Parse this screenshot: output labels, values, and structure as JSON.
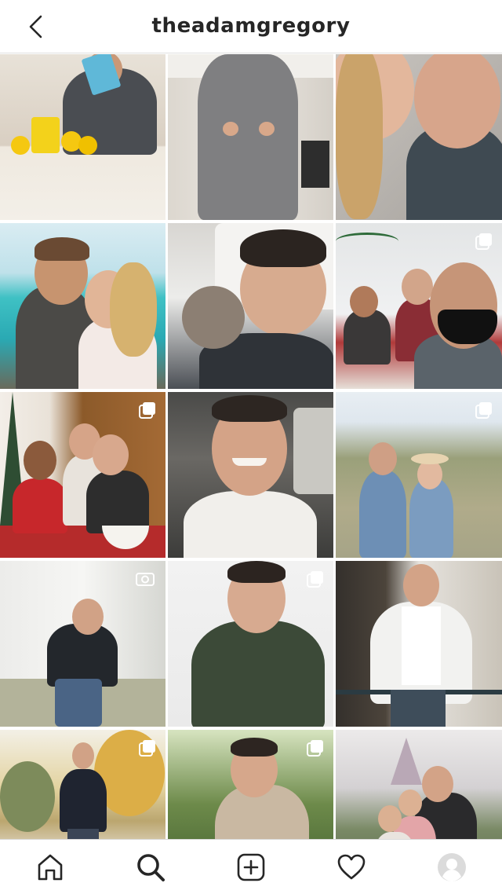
{
  "header": {
    "title": "theadamgregory",
    "back_icon": "chevron-left-icon"
  },
  "grid": {
    "posts": [
      {
        "name": "post-lemon-drops",
        "badge": null
      },
      {
        "name": "post-grey-sweater-kitchen",
        "badge": null
      },
      {
        "name": "post-kiss-selfie",
        "badge": null
      },
      {
        "name": "post-beach-kiss",
        "badge": null
      },
      {
        "name": "post-nap-with-dog",
        "badge": null
      },
      {
        "name": "post-masked-selfie-set",
        "badge": "carousel-icon"
      },
      {
        "name": "post-christmas-family",
        "badge": "carousel-icon"
      },
      {
        "name": "post-car-selfie",
        "badge": null
      },
      {
        "name": "post-couple-hillside",
        "badge": "carousel-icon"
      },
      {
        "name": "post-jump-outdoors",
        "badge": "video-icon"
      },
      {
        "name": "post-green-sweater",
        "badge": "carousel-icon"
      },
      {
        "name": "post-white-shirt-balcony",
        "badge": null
      },
      {
        "name": "post-autumn-tree",
        "badge": "carousel-icon"
      },
      {
        "name": "post-pumpkins",
        "badge": "carousel-icon"
      },
      {
        "name": "post-castle-kids",
        "badge": null
      }
    ]
  },
  "tabbar": {
    "tabs": [
      {
        "name": "tab-home",
        "icon": "home-icon"
      },
      {
        "name": "tab-search",
        "icon": "search-icon",
        "active": true
      },
      {
        "name": "tab-new-post",
        "icon": "plus-square-icon"
      },
      {
        "name": "tab-activity",
        "icon": "heart-icon"
      },
      {
        "name": "tab-profile",
        "icon": "avatar-icon"
      }
    ]
  },
  "colors": {
    "text": "#262626",
    "divider": "#dbdbdb",
    "background": "#ffffff"
  }
}
